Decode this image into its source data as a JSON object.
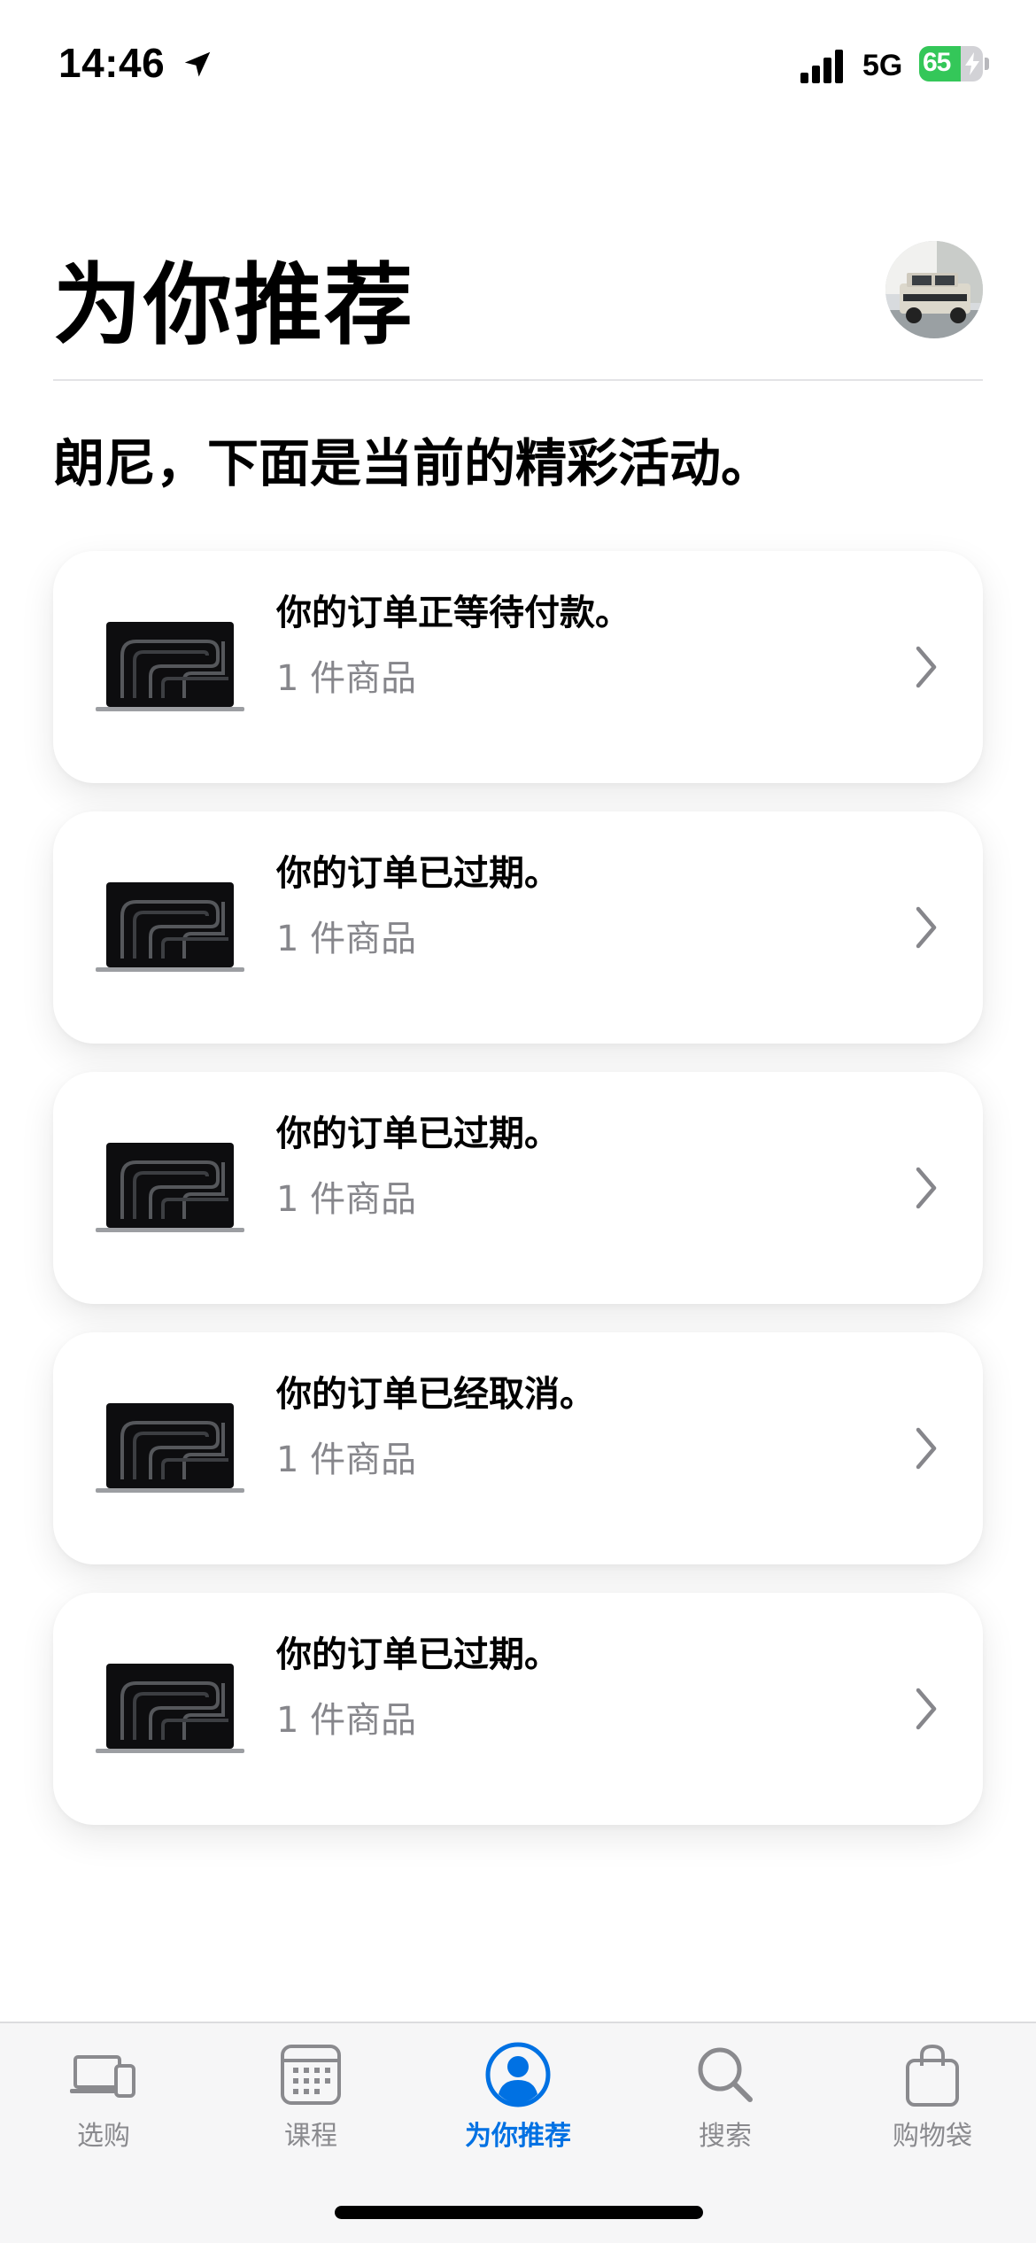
{
  "status_bar": {
    "time": "14:46",
    "network": "5G",
    "battery_percent": "65",
    "battery_level": 0.65,
    "battery_color": "#34c759",
    "icons": [
      "location-arrow-icon",
      "cellular-signal-icon",
      "charging-bolt-icon"
    ]
  },
  "header": {
    "title": "为你推荐",
    "avatar_icon": "profile-photo-avatar"
  },
  "greeting": "朗尼，下面是当前的精彩活动。",
  "orders": [
    {
      "status": "你的订单正等待付款。",
      "items": "1 件商品"
    },
    {
      "status": "你的订单已过期。",
      "items": "1 件商品"
    },
    {
      "status": "你的订单已过期。",
      "items": "1 件商品"
    },
    {
      "status": "你的订单已经取消。",
      "items": "1 件商品"
    },
    {
      "status": "你的订单已过期。",
      "items": "1 件商品"
    }
  ],
  "tab_bar": {
    "active_color": "#0071e3",
    "inactive_color": "#8a8a8e",
    "tabs": [
      {
        "label": "选购",
        "icon": "devices-icon",
        "active": false
      },
      {
        "label": "课程",
        "icon": "calendar-icon",
        "active": false
      },
      {
        "label": "为你推荐",
        "icon": "person-icon",
        "active": true
      },
      {
        "label": "搜索",
        "icon": "search-icon",
        "active": false
      },
      {
        "label": "购物袋",
        "icon": "bag-icon",
        "active": false
      }
    ]
  }
}
